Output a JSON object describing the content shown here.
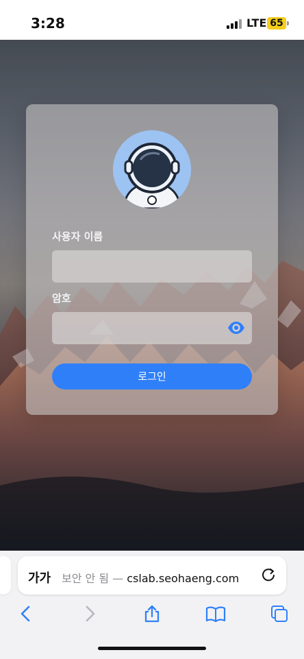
{
  "status_bar": {
    "time": "3:28",
    "network": "LTE",
    "battery": "65",
    "signal-icon": "signal-bars"
  },
  "login": {
    "avatar_icon": "astronaut-avatar",
    "username_label": "사용자 이름",
    "username_value": "",
    "password_label": "암호",
    "password_value": "",
    "show_password_icon": "eye-icon",
    "login_button": "로그인"
  },
  "browser": {
    "text_size_label": "가가",
    "not_secure_label": "보안 안 됨 — ",
    "url": "cslab.seohaeng.com",
    "reload_icon": "reload-icon",
    "toolbar": [
      "back-icon",
      "forward-icon",
      "share-icon",
      "bookmarks-icon",
      "tabs-icon"
    ]
  },
  "colors": {
    "accent": "#2f80f8",
    "battery": "#f4cd1d",
    "avatar_bg": "#9dc3f3"
  }
}
